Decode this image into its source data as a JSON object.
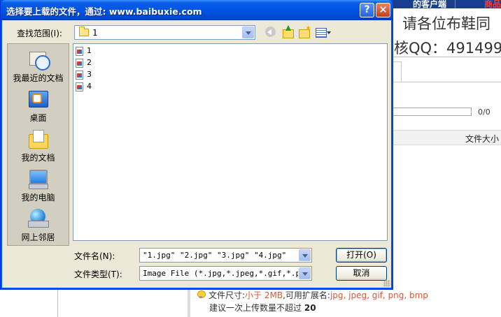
{
  "background": {
    "topbar_left": "的客户端",
    "topbar_right": "商品",
    "banner_line1": "请各位布鞋同",
    "banner_line2": "核QQ：491499",
    "progress_text": "0/0",
    "column_header": "文件大小",
    "hint_size_prefix": "文件尺寸:",
    "hint_size_value": "小于 2MB",
    "hint_ext_prefix": ",可用扩展名:",
    "hint_ext_value": "jpg, jpeg, gif, png, bmp",
    "hint_count_text": "建议一次上传数量不超过",
    "hint_count_value": "20"
  },
  "dialog": {
    "title": "选择要上载的文件，通过: www.baibuxie.com",
    "help_label": "?",
    "close_label": "✕",
    "look_in_label": "查找范围(I):",
    "look_in_value": "1",
    "places": [
      {
        "label": "我最近的文档",
        "icon": "recent-documents-icon"
      },
      {
        "label": "桌面",
        "icon": "desktop-icon"
      },
      {
        "label": "我的文档",
        "icon": "my-documents-icon"
      },
      {
        "label": "我的电脑",
        "icon": "my-computer-icon"
      },
      {
        "label": "网上邻居",
        "icon": "network-places-icon"
      }
    ],
    "files": [
      "1",
      "2",
      "3",
      "4"
    ],
    "filename_label": "文件名(N):",
    "filename_value": "\"1.jpg\" \"2.jpg\" \"3.jpg\" \"4.jpg\"",
    "filetype_label": "文件类型(T):",
    "filetype_value": "Image File (*.jpg,*.jpeg,*.gif,*.png,",
    "open_button": "打开(O)",
    "cancel_button": "取消"
  }
}
